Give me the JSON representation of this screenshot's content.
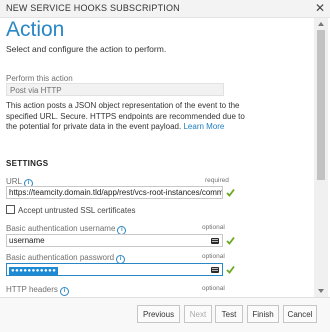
{
  "dialog": {
    "title": "NEW SERVICE HOOKS SUBSCRIPTION",
    "close": "✕"
  },
  "page": {
    "title": "Action",
    "subtitle": "Select and configure the action to perform."
  },
  "perform_action": {
    "label": "Perform this action",
    "value": "Post via HTTP"
  },
  "description": {
    "text": "This action posts a JSON object representation of the event to the specified URL. Secure. HTTPS endpoints are recommended due to the potential for private data in the event payload.",
    "link": "Learn More"
  },
  "settings": {
    "heading": "SETTINGS",
    "url": {
      "label": "URL",
      "required": "required",
      "value": "https://teamcity.domain.tld/app/rest/vcs-root-instances/commitHookNotification?locator=vcsRoot:(type:jetbrains.git)"
    },
    "ssl_checkbox": {
      "label": "Accept untrusted SSL certificates",
      "checked": false
    },
    "username": {
      "label": "Basic authentication username",
      "optional": "optional",
      "value": "username"
    },
    "password": {
      "label": "Basic authentication password",
      "optional": "optional",
      "value": "●●●●●●●●●●●"
    },
    "headers": {
      "label": "HTTP headers",
      "optional": "optional"
    }
  },
  "footer": {
    "previous": "Previous",
    "next": "Next",
    "test": "Test",
    "finish": "Finish",
    "cancel": "Cancel"
  },
  "colors": {
    "accent": "#2a87c6",
    "valid": "#6aa821"
  },
  "icons": [
    "close-icon",
    "info-icon",
    "checkmark-icon",
    "keyboard-icon",
    "scroll-up-icon",
    "scroll-down-icon"
  ]
}
